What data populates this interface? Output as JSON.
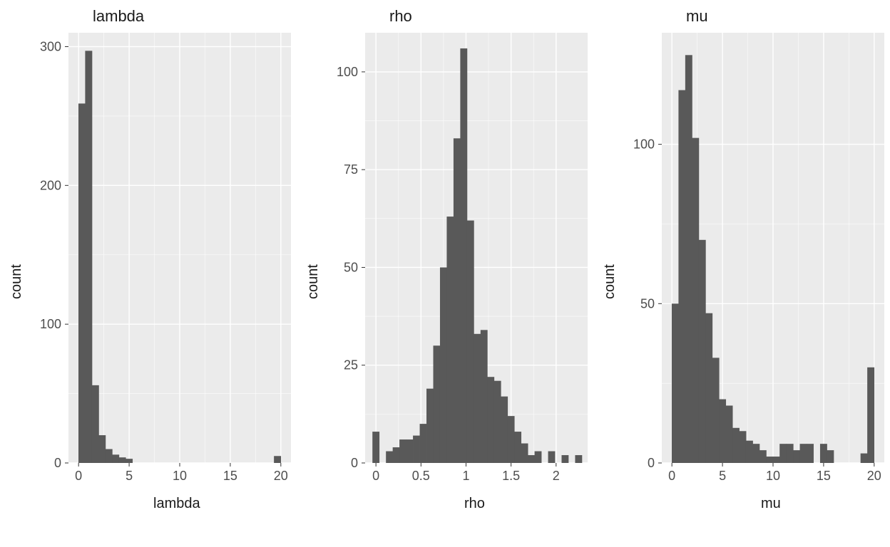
{
  "chart_data": [
    {
      "type": "bar",
      "title": "lambda",
      "xlabel": "lambda",
      "ylabel": "count",
      "xlim": [
        -1,
        21
      ],
      "ylim": [
        0,
        310
      ],
      "x_ticks": [
        0,
        5,
        10,
        15,
        20
      ],
      "y_ticks": [
        0,
        100,
        200,
        300
      ],
      "bin_width": 0.7,
      "categories_x": [
        0.333,
        1.0,
        1.667,
        2.333,
        3.0,
        3.667,
        4.333,
        5.0,
        19.667
      ],
      "values": [
        259,
        297,
        56,
        20,
        10,
        6,
        4,
        3,
        5
      ]
    },
    {
      "type": "bar",
      "title": "rho",
      "xlabel": "rho",
      "ylabel": "count",
      "xlim": [
        -0.12,
        2.35
      ],
      "ylim": [
        0,
        110
      ],
      "x_ticks": [
        0.0,
        0.5,
        1.0,
        1.5,
        2.0
      ],
      "y_ticks": [
        0,
        25,
        50,
        75,
        100
      ],
      "bin_width": 0.078,
      "categories_x": [
        0.0,
        0.15,
        0.225,
        0.3,
        0.375,
        0.45,
        0.525,
        0.6,
        0.675,
        0.75,
        0.825,
        0.9,
        0.975,
        1.05,
        1.125,
        1.2,
        1.275,
        1.35,
        1.425,
        1.5,
        1.575,
        1.65,
        1.725,
        1.8,
        1.95,
        2.1,
        2.25
      ],
      "values": [
        8,
        3,
        4,
        6,
        6,
        7,
        10,
        19,
        30,
        50,
        63,
        83,
        106,
        62,
        33,
        34,
        22,
        21,
        17,
        12,
        8,
        5,
        2,
        3,
        3,
        2,
        2
      ]
    },
    {
      "type": "bar",
      "title": "mu",
      "xlabel": "mu",
      "ylabel": "count",
      "xlim": [
        -1,
        21
      ],
      "ylim": [
        0,
        135
      ],
      "x_ticks": [
        0,
        5,
        10,
        15,
        20
      ],
      "y_ticks": [
        0,
        50,
        100
      ],
      "bin_width": 0.7,
      "categories_x": [
        0.333,
        1.0,
        1.667,
        2.333,
        3.0,
        3.667,
        4.333,
        5.0,
        5.667,
        6.333,
        7.0,
        7.667,
        8.333,
        9.0,
        9.667,
        10.333,
        11.0,
        11.667,
        12.333,
        13.0,
        13.667,
        15.0,
        15.667,
        19.0,
        19.667
      ],
      "values": [
        50,
        117,
        128,
        102,
        70,
        47,
        33,
        20,
        18,
        11,
        10,
        7,
        6,
        4,
        2,
        2,
        6,
        6,
        4,
        6,
        6,
        6,
        4,
        3,
        30
      ]
    }
  ]
}
